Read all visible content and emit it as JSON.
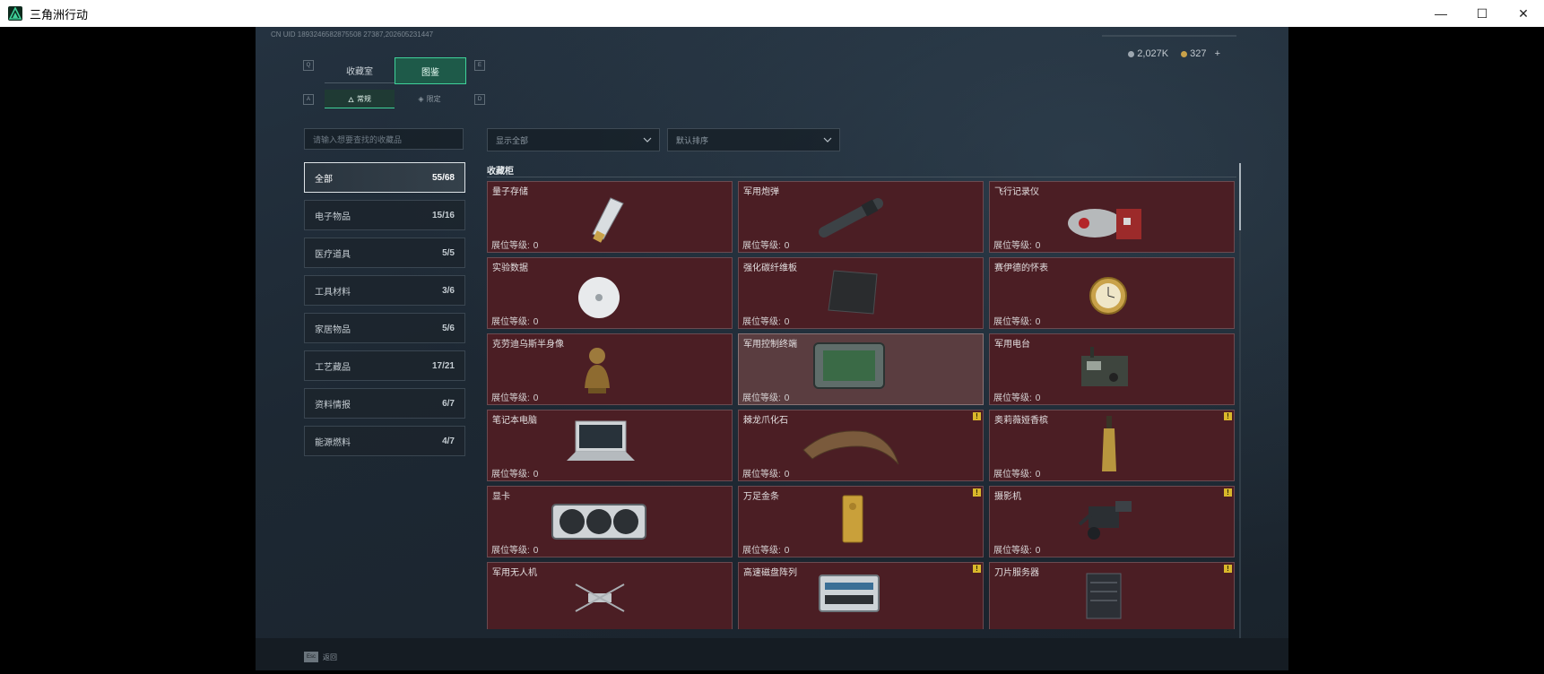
{
  "window": {
    "title": "三角洲行动",
    "minimize": "—",
    "maximize": "☐",
    "close": "✕"
  },
  "uid": "CN UID 1893246582875508 27387,202605231447",
  "currency": {
    "silver": "2,027K",
    "gold": "327",
    "add": "+"
  },
  "tabs_main": [
    "收藏室",
    "图鉴"
  ],
  "tabs_sub": [
    "常规",
    "限定"
  ],
  "search_placeholder": "请输入想要查找的收藏品",
  "filter_show": "显示全部",
  "filter_sort": "默认排序",
  "section_title": "收藏柜",
  "level_label": "展位等级:",
  "categories": [
    {
      "name": "全部",
      "count": "55/68"
    },
    {
      "name": "电子物品",
      "count": "15/16"
    },
    {
      "name": "医疗道具",
      "count": "5/5"
    },
    {
      "name": "工具材料",
      "count": "3/6"
    },
    {
      "name": "家居物品",
      "count": "5/6"
    },
    {
      "name": "工艺藏品",
      "count": "17/21"
    },
    {
      "name": "资料情报",
      "count": "6/7"
    },
    {
      "name": "能源燃料",
      "count": "4/7"
    }
  ],
  "items": [
    {
      "name": "量子存储",
      "level": "0",
      "icon": "usb-drive-icon",
      "badge": ""
    },
    {
      "name": "军用炮弹",
      "level": "0",
      "icon": "artillery-shell-icon",
      "badge": ""
    },
    {
      "name": "飞行记录仪",
      "level": "0",
      "icon": "flight-recorder-icon",
      "badge": ""
    },
    {
      "name": "实验数据",
      "level": "0",
      "icon": "disc-icon",
      "badge": ""
    },
    {
      "name": "强化碳纤维板",
      "level": "0",
      "icon": "carbon-plate-icon",
      "badge": ""
    },
    {
      "name": "赛伊德的怀表",
      "level": "0",
      "icon": "pocket-watch-icon",
      "badge": ""
    },
    {
      "name": "克劳迪乌斯半身像",
      "level": "0",
      "icon": "bust-icon",
      "badge": ""
    },
    {
      "name": "军用控制终端",
      "level": "0",
      "icon": "control-terminal-icon",
      "badge": ""
    },
    {
      "name": "军用电台",
      "level": "0",
      "icon": "radio-icon",
      "badge": ""
    },
    {
      "name": "笔记本电脑",
      "level": "0",
      "icon": "laptop-icon",
      "badge": ""
    },
    {
      "name": "棘龙爪化石",
      "level": "0",
      "icon": "claw-fossil-icon",
      "badge": "!"
    },
    {
      "name": "奥莉薇娅香槟",
      "level": "0",
      "icon": "champagne-icon",
      "badge": "!"
    },
    {
      "name": "显卡",
      "level": "0",
      "icon": "graphics-card-icon",
      "badge": ""
    },
    {
      "name": "万足金条",
      "level": "0",
      "icon": "gold-bar-icon",
      "badge": "!"
    },
    {
      "name": "摄影机",
      "level": "0",
      "icon": "camera-icon",
      "badge": "!"
    },
    {
      "name": "军用无人机",
      "level": "",
      "icon": "drone-icon",
      "badge": ""
    },
    {
      "name": "高速磁盘阵列",
      "level": "",
      "icon": "disk-array-icon",
      "badge": "!"
    },
    {
      "name": "刀片服务器",
      "level": "",
      "icon": "blade-server-icon",
      "badge": "!"
    }
  ],
  "esc": {
    "key": "Esc",
    "label": "返回"
  },
  "keys": {
    "q": "Q",
    "e": "E",
    "a": "A",
    "d": "D"
  }
}
